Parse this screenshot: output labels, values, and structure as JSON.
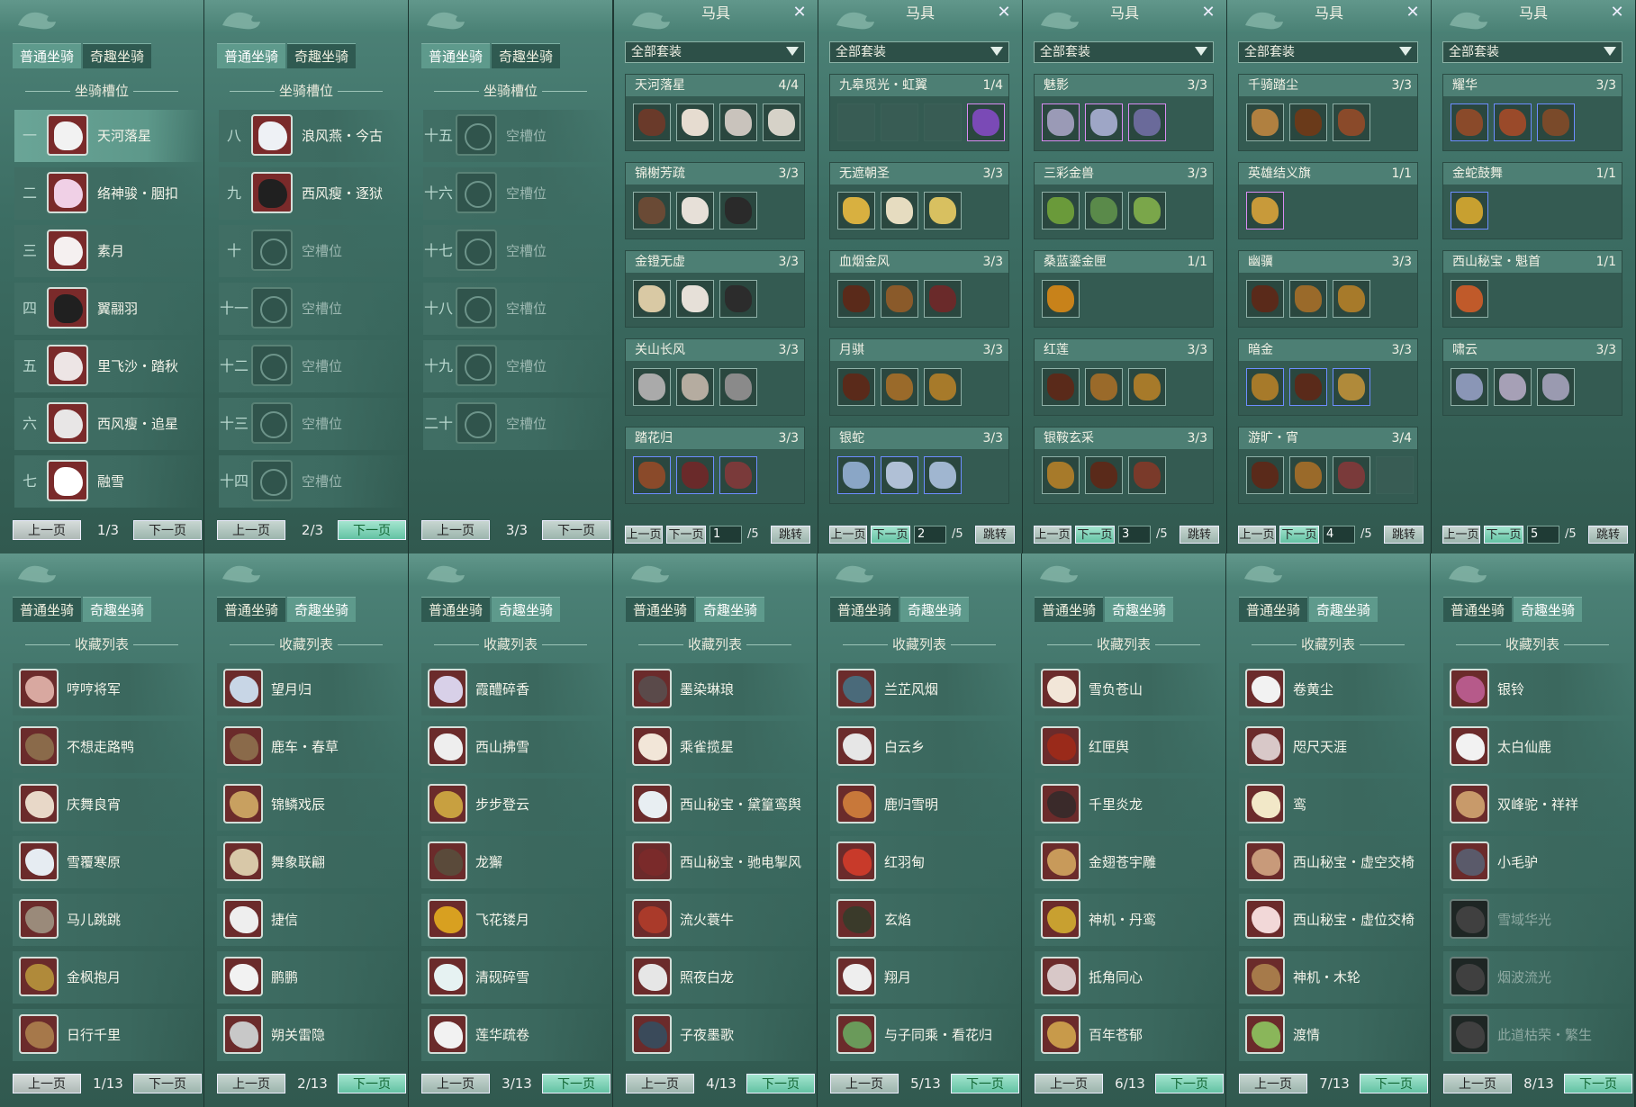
{
  "colors": {
    "accent": "#5e9a8c",
    "panel": "#3c6d63",
    "active_button": "#63c2a3"
  },
  "tabs": {
    "normal": "普通坐骑",
    "fun": "奇趣坐骑"
  },
  "slot_section": "坐骑槽位",
  "collect_section": "收藏列表",
  "pager": {
    "prev": "上一页",
    "next": "下一页"
  },
  "slot_panels": [
    {
      "page": "1/3",
      "rows": [
        {
          "num": "一",
          "name": "天河落星",
          "empty": false,
          "selected": true,
          "color": "#f2f2f2"
        },
        {
          "num": "二",
          "name": "络神骏・胭扣",
          "empty": false,
          "color": "#f0d0e6"
        },
        {
          "num": "三",
          "name": "素月",
          "empty": false,
          "color": "#f5f0f0"
        },
        {
          "num": "四",
          "name": "翼翮羽",
          "empty": false,
          "color": "#202020"
        },
        {
          "num": "五",
          "name": "里飞沙・踏秋",
          "empty": false,
          "color": "#ede5e5"
        },
        {
          "num": "六",
          "name": "西风瘦・追星",
          "empty": false,
          "color": "#e8e6e6"
        },
        {
          "num": "七",
          "name": "融雪",
          "empty": false,
          "color": "#ffffff"
        }
      ]
    },
    {
      "page": "2/3",
      "rows": [
        {
          "num": "八",
          "name": "浪风燕・今古",
          "empty": false,
          "color": "#eef1f5"
        },
        {
          "num": "九",
          "name": "西风瘦・逐狱",
          "empty": false,
          "color": "#202020"
        },
        {
          "num": "十",
          "name": "空槽位",
          "empty": true
        },
        {
          "num": "十一",
          "name": "空槽位",
          "empty": true
        },
        {
          "num": "十二",
          "name": "空槽位",
          "empty": true
        },
        {
          "num": "十三",
          "name": "空槽位",
          "empty": true
        },
        {
          "num": "十四",
          "name": "空槽位",
          "empty": true
        }
      ]
    },
    {
      "page": "3/3",
      "rows": [
        {
          "num": "十五",
          "name": "空槽位",
          "empty": true
        },
        {
          "num": "十六",
          "name": "空槽位",
          "empty": true
        },
        {
          "num": "十七",
          "name": "空槽位",
          "empty": true
        },
        {
          "num": "十八",
          "name": "空槽位",
          "empty": true
        },
        {
          "num": "十九",
          "name": "空槽位",
          "empty": true
        },
        {
          "num": "二十",
          "name": "空槽位",
          "empty": true
        }
      ]
    }
  ],
  "saddle": {
    "title": "马具",
    "filter": "全部套装",
    "jump": "跳转",
    "total": "/5",
    "panels": [
      {
        "page": "1",
        "groups": [
          {
            "name": "天河落星",
            "count": "4/4",
            "items": [
              "#6a3a2a",
              "#e6dcd0",
              "#c9c3bc",
              "#d6d2c8"
            ]
          },
          {
            "name": "锦榭芳疏",
            "count": "3/3",
            "items": [
              "#6a4a35",
              "#e7e0d8",
              "#2a2a2a"
            ]
          },
          {
            "name": "金镫无虚",
            "count": "3/3",
            "items": [
              "#d9c9a4",
              "#e6e0d8",
              "#2c2c2c"
            ]
          },
          {
            "name": "关山长风",
            "count": "3/3",
            "items": [
              "#aaaaaa",
              "#b5aca0",
              "#8a8a8a"
            ]
          },
          {
            "name": "踏花归",
            "count": "3/3",
            "items": [
              "#8a4a2a",
              "#6a2a2a",
              "#7a3a3a"
            ],
            "q": 2
          }
        ]
      },
      {
        "page": "2",
        "groups": [
          {
            "name": "九皋觅光・虹翼",
            "count": "1/4",
            "items": [
              "",
              "",
              "",
              "#7a4ab6"
            ],
            "q": 1
          },
          {
            "name": "无遮朝圣",
            "count": "3/3",
            "items": [
              "#d8b040",
              "#e6dcc0",
              "#d8c060"
            ]
          },
          {
            "name": "血烟金风",
            "count": "3/3",
            "items": [
              "#5a2a1a",
              "#8a5a2a",
              "#6a2a2a"
            ]
          },
          {
            "name": "月骐",
            "count": "3/3",
            "items": [
              "#5a2a1a",
              "#9a6a2a",
              "#a77a2a"
            ]
          },
          {
            "name": "银蛇",
            "count": "3/3",
            "items": [
              "#8aa6c6",
              "#b0c0d6",
              "#a0b6d0"
            ],
            "q": 2
          }
        ]
      },
      {
        "page": "3",
        "groups": [
          {
            "name": "魅影",
            "count": "3/3",
            "items": [
              "#9a9ab6",
              "#9ea6c6",
              "#6a6a9a"
            ],
            "q": 1
          },
          {
            "name": "三彩金兽",
            "count": "3/3",
            "items": [
              "#6a9a3a",
              "#5a8a4a",
              "#7aa64a"
            ]
          },
          {
            "name": "桑蓝鎏金匣",
            "count": "1/1",
            "items": [
              "#c8821a"
            ]
          },
          {
            "name": "红莲",
            "count": "3/3",
            "items": [
              "#5a2a1a",
              "#9a6a2a",
              "#a77a2a"
            ]
          },
          {
            "name": "银鞍玄采",
            "count": "3/3",
            "items": [
              "#a77a2a",
              "#5a2a1a",
              "#7a3a2a"
            ]
          }
        ]
      },
      {
        "page": "4",
        "groups": [
          {
            "name": "千骑踏尘",
            "count": "3/3",
            "items": [
              "#b08040",
              "#6a3a1a",
              "#8a4a2a"
            ]
          },
          {
            "name": "英雄结义旗",
            "count": "1/1",
            "items": [
              "#c89a3a"
            ],
            "q": 1
          },
          {
            "name": "幽骥",
            "count": "3/3",
            "items": [
              "#5a2a1a",
              "#9a6a2a",
              "#a77a2a"
            ]
          },
          {
            "name": "暗金",
            "count": "3/3",
            "items": [
              "#a77a2a",
              "#5a2a1a",
              "#b08a3a"
            ],
            "q": 2
          },
          {
            "name": "游旷・宵",
            "count": "3/4",
            "items": [
              "#5a2a1a",
              "#9a6a2a",
              "#7a3a3a",
              ""
            ]
          }
        ]
      },
      {
        "page": "5",
        "groups": [
          {
            "name": "耀华",
            "count": "3/3",
            "items": [
              "#8a4a2a",
              "#9a4a2a",
              "#7a4a2a"
            ],
            "q": 2
          },
          {
            "name": "金蛇鼓舞",
            "count": "1/1",
            "items": [
              "#c8a030"
            ],
            "q": 2
          },
          {
            "name": "西山秘宝・魁首",
            "count": "1/1",
            "items": [
              "#c05a2a"
            ]
          },
          {
            "name": "啸云",
            "count": "3/3",
            "items": [
              "#8a96b6",
              "#a6a0b6",
              "#9a9ab0"
            ]
          }
        ]
      }
    ]
  },
  "collect_panels": [
    {
      "page": "1/13",
      "items": [
        {
          "name": "哼哼将军",
          "color": "#d8a8a0"
        },
        {
          "name": "不想走路鸭",
          "color": "#8a6a4a"
        },
        {
          "name": "庆舞良宵",
          "color": "#e8d8c8"
        },
        {
          "name": "雪覆寒原",
          "color": "#e6ecf2"
        },
        {
          "name": "马儿跳跳",
          "color": "#9a8a7a"
        },
        {
          "name": "金枫抱月",
          "color": "#b08a3a"
        },
        {
          "name": "日行千里",
          "color": "#a6784a"
        }
      ]
    },
    {
      "page": "2/13",
      "items": [
        {
          "name": "望月归",
          "color": "#c8d6e6"
        },
        {
          "name": "鹿车・春草",
          "color": "#8a6a4a"
        },
        {
          "name": "锦鳞戏辰",
          "color": "#c8a060"
        },
        {
          "name": "舞象联翩",
          "color": "#d8c8a8"
        },
        {
          "name": "捷信",
          "color": "#eeeeee"
        },
        {
          "name": "鹏鹏",
          "color": "#f2f2f2"
        },
        {
          "name": "朔关雷隐",
          "color": "#c8c8c8"
        }
      ]
    },
    {
      "page": "3/13",
      "items": [
        {
          "name": "霞醴碎香",
          "color": "#d8d0e8"
        },
        {
          "name": "西山拂雪",
          "color": "#eeeeee"
        },
        {
          "name": "步步登云",
          "color": "#c8a040"
        },
        {
          "name": "龙獬",
          "color": "#5a4a3a"
        },
        {
          "name": "飞花镂月",
          "color": "#d8a020"
        },
        {
          "name": "清砚碎雪",
          "color": "#e6f2f2"
        },
        {
          "name": "莲华疏卷",
          "color": "#f2f2f2"
        }
      ]
    },
    {
      "page": "4/13",
      "items": [
        {
          "name": "墨染琳琅",
          "color": "#5a4a4a"
        },
        {
          "name": "乘雀揽星",
          "color": "#f2e6d8"
        },
        {
          "name": "西山秘宝・黛篁鸾舆",
          "color": "#e8eef2"
        },
        {
          "name": "西山秘宝・驰电掣风",
          "color": "#7a2a2a"
        },
        {
          "name": "流火蓑牛",
          "color": "#aa3a2a"
        },
        {
          "name": "照夜白龙",
          "color": "#e6e6e6"
        },
        {
          "name": "子夜墨歌",
          "color": "#3a4a5a"
        }
      ]
    },
    {
      "page": "5/13",
      "items": [
        {
          "name": "兰芷风烟",
          "color": "#4a6a7a"
        },
        {
          "name": "白云乡",
          "color": "#e6e6e6"
        },
        {
          "name": "鹿归雪明",
          "color": "#c8783a"
        },
        {
          "name": "红羽甸",
          "color": "#c83a2a"
        },
        {
          "name": "玄焰",
          "color": "#3a3a2a"
        },
        {
          "name": "翔月",
          "color": "#eeeeee"
        },
        {
          "name": "与子同乘・看花归",
          "color": "#6a9a5a"
        }
      ]
    },
    {
      "page": "6/13",
      "items": [
        {
          "name": "雪负苍山",
          "color": "#f2e6d8"
        },
        {
          "name": "红匣舆",
          "color": "#9a2a1a"
        },
        {
          "name": "千里炎龙",
          "color": "#3a2a2a"
        },
        {
          "name": "金翅苍宇雕",
          "color": "#c89a5a"
        },
        {
          "name": "神机・丹鸾",
          "color": "#c8a030"
        },
        {
          "name": "抵角同心",
          "color": "#d8c8c8"
        },
        {
          "name": "百年苍郁",
          "color": "#c89a4a"
        }
      ]
    },
    {
      "page": "7/13",
      "items": [
        {
          "name": "卷黄尘",
          "color": "#f2f2f2"
        },
        {
          "name": "咫尺天涯",
          "color": "#d8c8c8"
        },
        {
          "name": "鸾",
          "color": "#f2e8c8"
        },
        {
          "name": "西山秘宝・虚空交椅",
          "color": "#c89a7a"
        },
        {
          "name": "西山秘宝・虚位交椅",
          "color": "#f2d8d8"
        },
        {
          "name": "神机・木轮",
          "color": "#a67a4a"
        },
        {
          "name": "渡情",
          "color": "#8ab65a"
        }
      ]
    },
    {
      "page": "8/13",
      "items": [
        {
          "name": "银铃",
          "color": "#b65a8a"
        },
        {
          "name": "太白仙鹿",
          "color": "#f2f2f2"
        },
        {
          "name": "双峰驼・祥祥",
          "color": "#c89a6a"
        },
        {
          "name": "小毛驴",
          "color": "#5a5a6a"
        },
        {
          "name": "雪域华光",
          "color": "#404040",
          "dim": true
        },
        {
          "name": "烟波流光",
          "color": "#404040",
          "dim": true
        },
        {
          "name": "此道枯荣・繁生",
          "color": "#404040",
          "dim": true
        }
      ]
    }
  ]
}
